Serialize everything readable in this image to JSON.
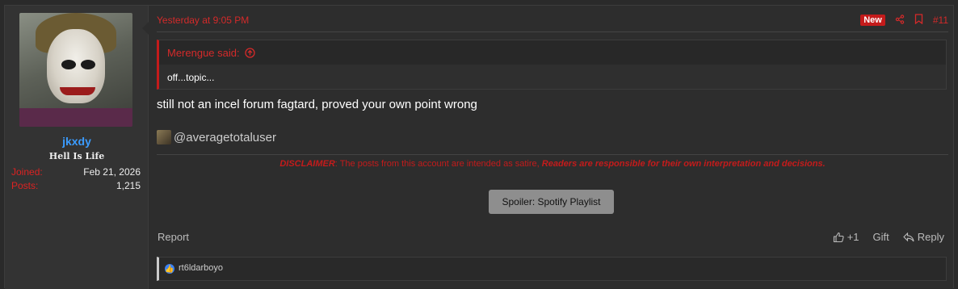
{
  "post": {
    "time": "Yesterday at 9:05 PM",
    "new_label": "New",
    "post_number": "#11",
    "share_icon": "share-icon",
    "bookmark_icon": "bookmark-icon"
  },
  "user": {
    "name": "jkxdy",
    "title": "Hell Is Life",
    "joined_label": "Joined:",
    "joined": "Feb 21, 2026",
    "posts_label": "Posts:",
    "posts": "1,215"
  },
  "quote": {
    "author": "Merengue said:",
    "text": "off...topic..."
  },
  "body_text": "still not an incel forum fagtard, proved your own point wrong",
  "signature": {
    "mention": "@averagetotaluser",
    "disclaimer_lead": "DISCLAIMER",
    "disclaimer_mid": ": The posts from this account are intended as satire, ",
    "disclaimer_tail": "Readers are responsible for their own interpretation and decisions.",
    "spoiler_label": "Spoiler: Spotify Playlist"
  },
  "footer": {
    "report": "Report",
    "like_count": "+1",
    "gift": "Gift",
    "reply": "Reply"
  },
  "reactions": {
    "users": "rt6ldarboyo"
  },
  "colors": {
    "accent": "#c41b1b",
    "link": "#3b9cff",
    "background": "#2d2d2d"
  }
}
